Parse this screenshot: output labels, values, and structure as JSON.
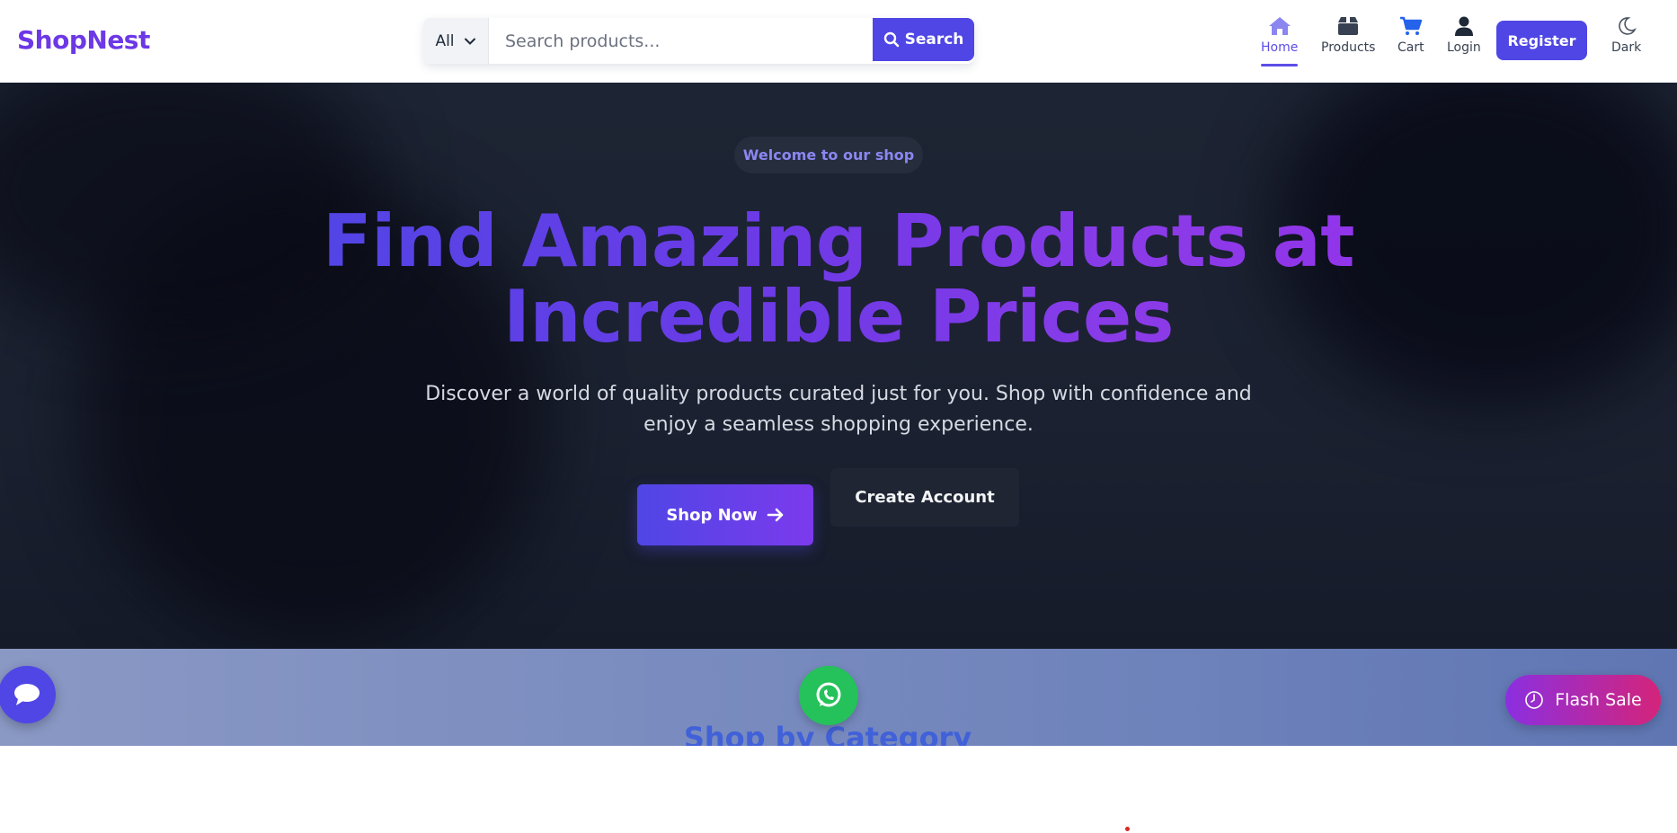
{
  "brand": {
    "logo": "ShopNest"
  },
  "search": {
    "category_label": "All",
    "placeholder": "Search products...",
    "button_label": "Search"
  },
  "nav": {
    "home": "Home",
    "products": "Products",
    "cart": "Cart",
    "login": "Login",
    "register": "Register",
    "dark": "Dark",
    "active": "Home"
  },
  "hero": {
    "badge": "Welcome to our shop",
    "title_line1": "Find Amazing Products at",
    "title_line2": "Incredible Prices",
    "subtitle_line1": "Discover a world of quality products curated just for you. Shop with confidence and",
    "subtitle_line2": "enjoy a seamless shopping experience.",
    "primary_cta": "Shop Now",
    "secondary_cta": "Create Account"
  },
  "categories": {
    "heading": "Shop by Category"
  },
  "floating": {
    "flash_sale": "Flash Sale"
  },
  "colors": {
    "brand": "#6d38e6",
    "primary": "#4f46e5",
    "hero_bg": "#1d2433",
    "whatsapp": "#25c15a",
    "flash_start": "#8b2fe0",
    "flash_end": "#d4247a"
  },
  "icons": [
    "home-icon",
    "box-icon",
    "cart-icon",
    "user-icon",
    "moon-icon",
    "search-icon",
    "chevron-down-icon",
    "arrow-right-icon",
    "chat-icon",
    "whatsapp-icon",
    "clock-icon"
  ]
}
